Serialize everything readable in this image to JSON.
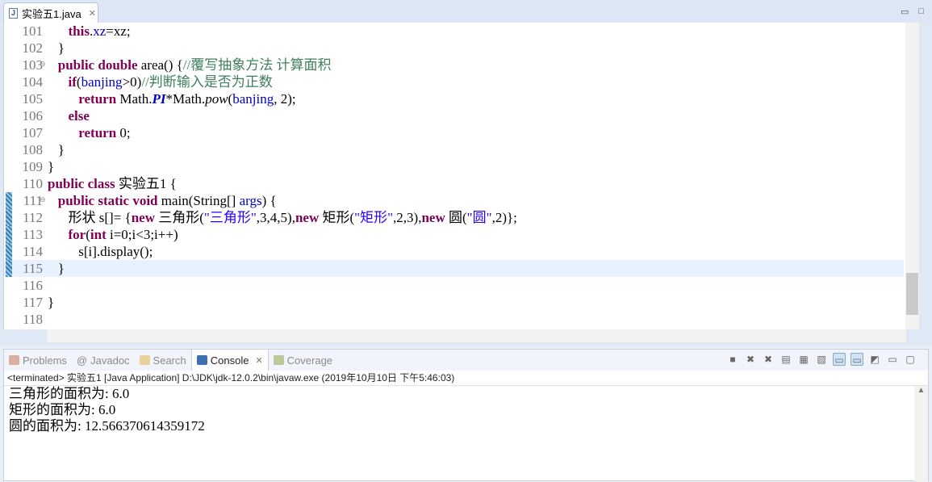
{
  "editor": {
    "tab_label": "实验五1.java",
    "lines": [
      {
        "n": "101",
        "tokens": [
          [
            "      ",
            ""
          ],
          [
            "this",
            "k"
          ],
          [
            ".",
            ""
          ],
          [
            "xz",
            "f"
          ],
          [
            "=xz;",
            ""
          ]
        ]
      },
      {
        "n": "102",
        "tokens": [
          [
            "   }",
            ""
          ]
        ]
      },
      {
        "n": "103",
        "tokens": [
          [
            "   ",
            ""
          ],
          [
            "public",
            "k"
          ],
          [
            " ",
            ""
          ],
          [
            "double",
            "k"
          ],
          [
            " area() {",
            ""
          ],
          [
            "//覆写抽象方法 计算面积",
            "c"
          ]
        ]
      },
      {
        "n": "104",
        "tokens": [
          [
            "      ",
            ""
          ],
          [
            "if",
            "k"
          ],
          [
            "(",
            ""
          ],
          [
            "banjing",
            "f"
          ],
          [
            ">0)",
            ""
          ],
          [
            "//判断输入是否为正数",
            "c"
          ]
        ]
      },
      {
        "n": "105",
        "tokens": [
          [
            "         ",
            ""
          ],
          [
            "return",
            "k"
          ],
          [
            " Math.",
            ""
          ],
          [
            "PI",
            "sf"
          ],
          [
            "*Math.",
            ""
          ],
          [
            "pow",
            "i"
          ],
          [
            "(",
            ""
          ],
          [
            "banjing",
            "f"
          ],
          [
            ", 2);",
            ""
          ]
        ]
      },
      {
        "n": "106",
        "tokens": [
          [
            "      ",
            ""
          ],
          [
            "else",
            "k"
          ]
        ]
      },
      {
        "n": "107",
        "tokens": [
          [
            "         ",
            ""
          ],
          [
            "return",
            "k"
          ],
          [
            " 0;",
            ""
          ]
        ]
      },
      {
        "n": "108",
        "tokens": [
          [
            "   }",
            ""
          ]
        ]
      },
      {
        "n": "109",
        "tokens": [
          [
            "}",
            ""
          ]
        ]
      },
      {
        "n": "110",
        "tokens": [
          [
            "public",
            "k"
          ],
          [
            " ",
            ""
          ],
          [
            "class",
            "k"
          ],
          [
            " 实验五1 {",
            ""
          ]
        ]
      },
      {
        "n": "111",
        "tokens": [
          [
            "   ",
            ""
          ],
          [
            "public",
            "k"
          ],
          [
            " ",
            ""
          ],
          [
            "static",
            "k"
          ],
          [
            " ",
            ""
          ],
          [
            "void",
            "k"
          ],
          [
            " main(String[] ",
            ""
          ],
          [
            "args",
            "f"
          ],
          [
            ") {",
            ""
          ]
        ]
      },
      {
        "n": "112",
        "tokens": [
          [
            "      形状 s[]= {",
            ""
          ],
          [
            "new",
            "k"
          ],
          [
            " 三角形(",
            ""
          ],
          [
            "\"三角形\"",
            "s"
          ],
          [
            ",3,4,5),",
            ""
          ],
          [
            "new",
            "k"
          ],
          [
            " 矩形(",
            ""
          ],
          [
            "\"矩形\"",
            "s"
          ],
          [
            ",2,3),",
            ""
          ],
          [
            "new",
            "k"
          ],
          [
            " 圆(",
            ""
          ],
          [
            "\"圆\"",
            "s"
          ],
          [
            ",2)};",
            ""
          ]
        ]
      },
      {
        "n": "113",
        "tokens": [
          [
            "      ",
            ""
          ],
          [
            "for",
            "k"
          ],
          [
            "(",
            ""
          ],
          [
            "int",
            "k"
          ],
          [
            " i=0;i<3;i++)",
            ""
          ]
        ]
      },
      {
        "n": "114",
        "tokens": [
          [
            "         s[i].display();",
            ""
          ]
        ]
      },
      {
        "n": "115",
        "tokens": [
          [
            "   }",
            ""
          ]
        ]
      },
      {
        "n": "116",
        "tokens": []
      },
      {
        "n": "117",
        "tokens": [
          [
            "}",
            ""
          ]
        ]
      },
      {
        "n": "118",
        "tokens": []
      }
    ]
  },
  "panel": {
    "tabs": [
      "Problems",
      "Javadoc",
      "Search",
      "Console",
      "Coverage"
    ],
    "status": "<terminated> 实验五1 [Java Application] D:\\JDK\\jdk-12.0.2\\bin\\javaw.exe (2019年10月10日 下午5:46:03)",
    "output": [
      "三角形的面积为: 6.0",
      "矩形的面积为: 6.0",
      "圆的面积为: 12.566370614359172"
    ]
  },
  "icons": {
    "tab": "java-file-icon",
    "toolbar": [
      "terminate-icon",
      "remove-launch-icon",
      "remove-all-icon",
      "clear-console-icon",
      "scroll-lock-icon",
      "word-wrap-icon",
      "show-on-stdout-icon",
      "show-on-stderr-icon",
      "pin-console-icon",
      "display-console-icon",
      "open-console-icon",
      "minimize-icon",
      "maximize-icon"
    ]
  }
}
